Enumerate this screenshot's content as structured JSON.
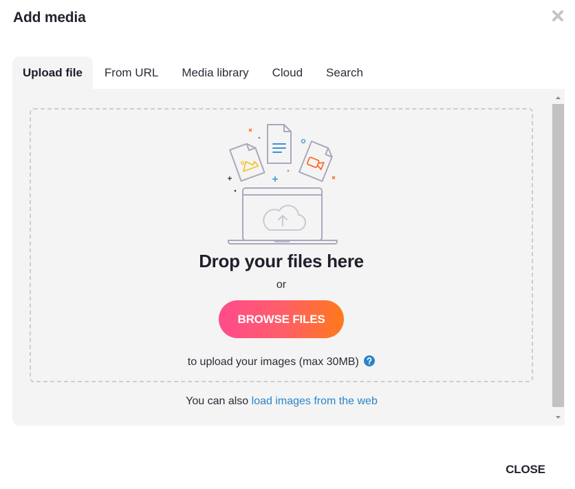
{
  "dialog": {
    "title": "Add media",
    "close_label": "CLOSE"
  },
  "tabs": [
    {
      "label": "Upload file",
      "active": true
    },
    {
      "label": "From URL",
      "active": false
    },
    {
      "label": "Media library",
      "active": false
    },
    {
      "label": "Cloud",
      "active": false
    },
    {
      "label": "Search",
      "active": false
    }
  ],
  "upload": {
    "heading": "Drop your files here",
    "or_text": "or",
    "browse_label": "BROWSE FILES",
    "hint": "to upload your images (max 30MB)",
    "also_prefix": "You can also",
    "web_link": "load images from the web"
  },
  "icons": {
    "close": "close-x-icon",
    "help": "question-circle-icon",
    "illustration": "laptop-upload-cloud-icon"
  },
  "colors": {
    "accent_link": "#2a84c9",
    "button_gradient_start": "#ff4b8d",
    "button_gradient_end": "#ff7a1a",
    "panel_bg": "#f4f4f4",
    "dropzone_border": "#cdcdcd",
    "image_icon": "#f4c430",
    "document_icon": "#3b8fd4",
    "video_icon": "#ff6a2a"
  }
}
